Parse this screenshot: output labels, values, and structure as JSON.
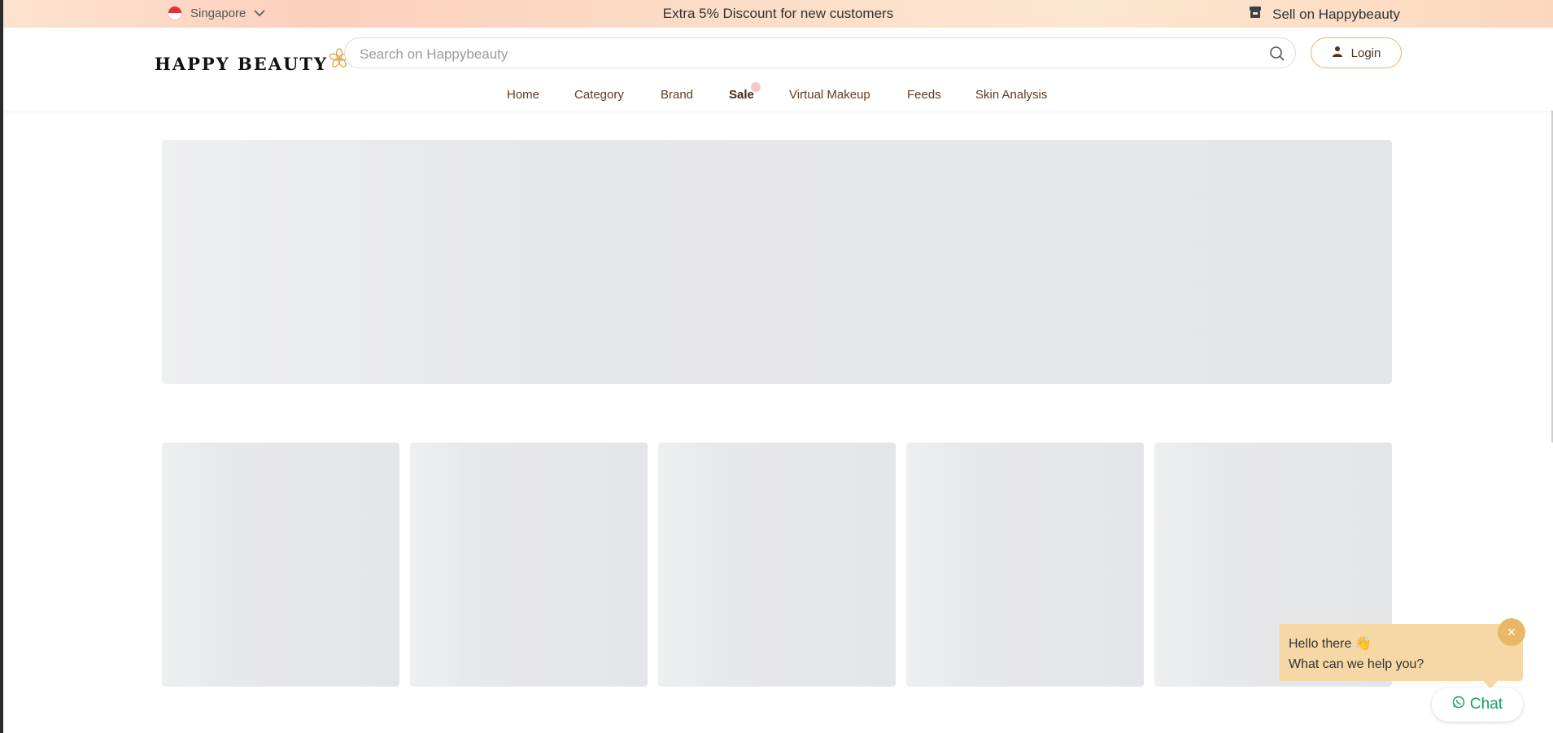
{
  "topbar": {
    "region": "Singapore",
    "promo": "Extra 5% Discount for new customers",
    "sell": "Sell on Happybeauty"
  },
  "header": {
    "logo_text": "HAPPY BEAUTY",
    "search_placeholder": "Search on Happybeauty",
    "login_label": "Login"
  },
  "nav": {
    "items": [
      "Home",
      "Category",
      "Brand",
      "Sale",
      "Virtual Makeup",
      "Feeds",
      "Skin Analysis"
    ]
  },
  "chat": {
    "greeting_line1": "Hello there 👋",
    "greeting_line2": "What can we help you?",
    "button_label": "Chat",
    "close_glyph": "×"
  },
  "colors": {
    "accent": "#eab766",
    "nav_text": "#5a3d22",
    "chat_green": "#14a05a",
    "skeleton": "#e6e7ea"
  }
}
